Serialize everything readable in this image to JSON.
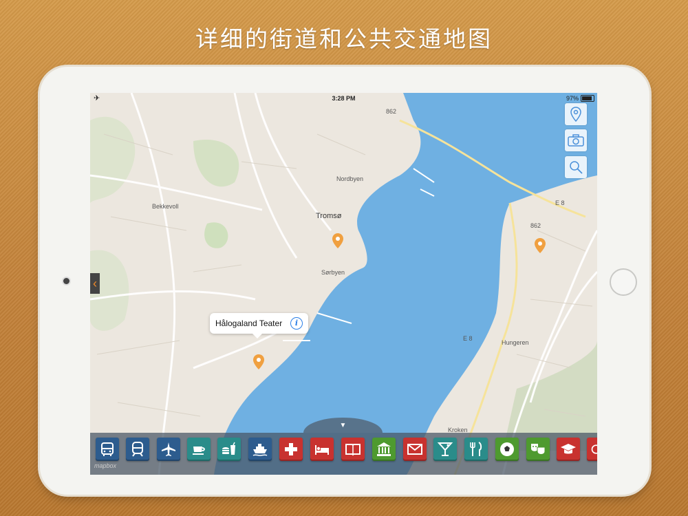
{
  "headline": "详细的街道和公共交通地图",
  "status_bar": {
    "time": "3:28 PM",
    "battery": "97%",
    "airplane_icon": "airplane-icon"
  },
  "map_buttons": [
    {
      "name": "location-pin-button",
      "icon": "location-pin-icon"
    },
    {
      "name": "camera-button",
      "icon": "camera-icon"
    },
    {
      "name": "search-button",
      "icon": "search-icon"
    }
  ],
  "map": {
    "labels": {
      "tromso": "Tromsø",
      "nordbyen": "Nordbyen",
      "sorbyen": "Sørbyen",
      "bekkevoll": "Bekkevoll",
      "hungeren": "Hungeren",
      "kroken": "Kroken",
      "e8": "E 8",
      "e8b": "E 8",
      "b62": "862",
      "b62b": "862"
    },
    "callout": {
      "title": "Hålogaland Teater",
      "info_glyph": "i"
    },
    "credit": "mapbox"
  },
  "toolbar": {
    "handle_glyph": "▼",
    "tools": [
      {
        "name": "bus-button",
        "icon": "bus-icon",
        "color": "#2d5c8e"
      },
      {
        "name": "train-button",
        "icon": "train-icon",
        "color": "#2d5c8e"
      },
      {
        "name": "airplane-button",
        "icon": "airplane-icon",
        "color": "#2d5c8e"
      },
      {
        "name": "cafe-button",
        "icon": "coffee-cup-icon",
        "color": "#2a8c8a"
      },
      {
        "name": "fast-food-button",
        "icon": "burger-drink-icon",
        "color": "#2a8c8a"
      },
      {
        "name": "ferry-button",
        "icon": "ship-icon",
        "color": "#2d5c8e"
      },
      {
        "name": "hospital-button",
        "icon": "medical-cross-icon",
        "color": "#c8322f"
      },
      {
        "name": "hotel-button",
        "icon": "bed-icon",
        "color": "#c8322f"
      },
      {
        "name": "library-button",
        "icon": "book-icon",
        "color": "#c8322f"
      },
      {
        "name": "museum-button",
        "icon": "bank-building-icon",
        "color": "#4e9a2f"
      },
      {
        "name": "post-office-button",
        "icon": "envelope-icon",
        "color": "#c8322f"
      },
      {
        "name": "bar-button",
        "icon": "cocktail-icon",
        "color": "#2a8c8a"
      },
      {
        "name": "restaurant-button",
        "icon": "fork-knife-icon",
        "color": "#2a8c8a"
      },
      {
        "name": "sports-button",
        "icon": "soccer-ball-icon",
        "color": "#4e9a2f"
      },
      {
        "name": "theater-button",
        "icon": "theater-masks-icon",
        "color": "#4e9a2f"
      },
      {
        "name": "university-button",
        "icon": "graduation-cap-icon",
        "color": "#c8322f"
      },
      {
        "name": "more-button",
        "icon": "circle-icon",
        "color": "#c8322f"
      }
    ]
  }
}
